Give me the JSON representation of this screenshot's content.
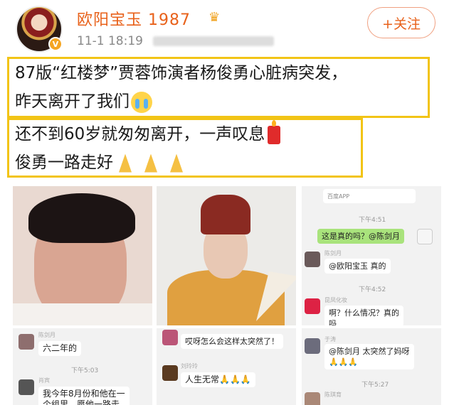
{
  "post": {
    "username": "欧阳宝玉 1987",
    "verified_badge": "V",
    "crown_icon": "crown-icon",
    "timestamp": "11-1 18:19",
    "follow_label": "+关注",
    "line1": "87版“红楼梦”贾蓉饰演者杨俊勇心脏病突发，",
    "line2": "昨天离开了我们",
    "line3": "还不到60岁就匆匆离开，一声叹息",
    "line4": "俊勇一路走好"
  },
  "chat1": {
    "app_label": "百度APP",
    "time1": "下午4:51",
    "msg1": "这是真的吗？@陈剑月",
    "name1": "陈剑月",
    "msg2": "@欧阳宝玉 真的",
    "time2": "下午4:52",
    "name2": "昆凤化妆",
    "msg3a": "啊？什么情况？真的",
    "msg3b": "吗"
  },
  "chat2": {
    "name1": "陈剑月",
    "msg1": "六二年的",
    "time1": "下午5:03",
    "name2": "肖宾",
    "msg2a": "我今年8月份和他在一",
    "msg2b": "个组里，愿他一路走"
  },
  "chat3": {
    "msg1": "哎呀怎么会这样太突然了！",
    "name1": "刘玲玲",
    "msg2": "人生无常🙏🙏🙏"
  },
  "chat4": {
    "name1": "于涛",
    "msg1": "@陈剑月 太突然了妈呀",
    "msg1b": "🙏🙏🙏",
    "time1": "下午5:27",
    "name2": "陈琪育"
  },
  "colors": {
    "accent": "#e8611a",
    "highlight_border": "#f2c416",
    "chat_green": "#a9e37c"
  }
}
